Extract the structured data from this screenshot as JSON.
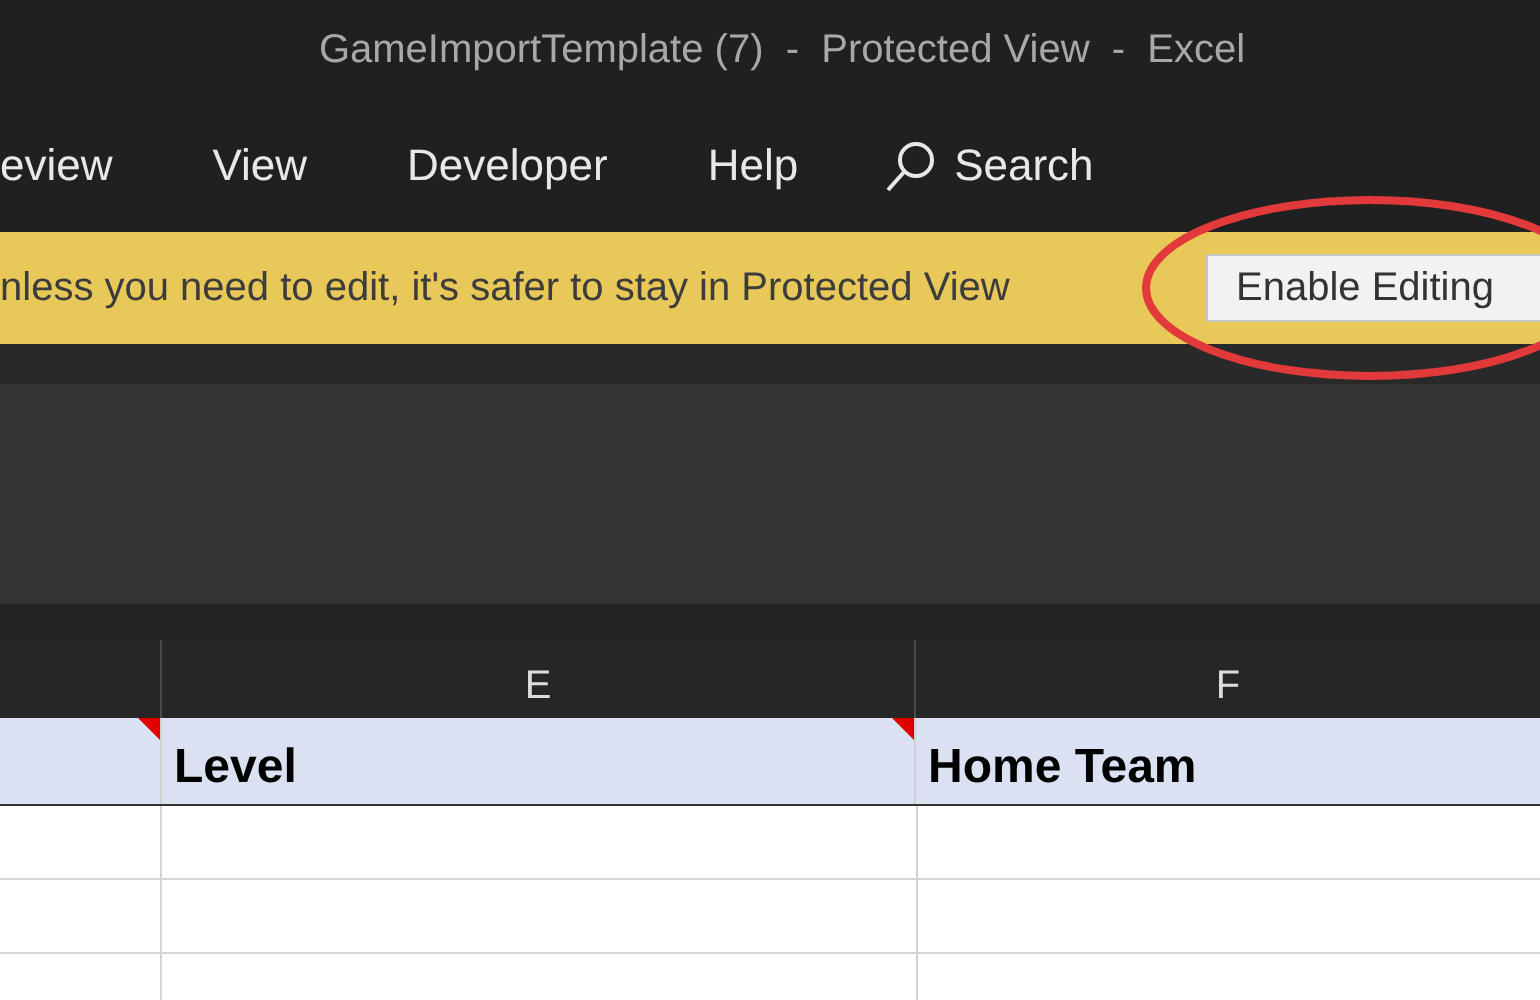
{
  "window": {
    "title": "GameImportTemplate (7)  -  Protected View  -  Excel"
  },
  "ribbon_tabs": [
    {
      "label": "eview"
    },
    {
      "label": "View"
    },
    {
      "label": "Developer"
    },
    {
      "label": "Help"
    }
  ],
  "search": {
    "label": "Search"
  },
  "message_bar": {
    "text": "nless you need to edit, it's safer to stay in Protected View",
    "button": "Enable Editing"
  },
  "sheet": {
    "columns": [
      "E",
      "F"
    ],
    "header_cells": [
      {
        "comment": true
      },
      {
        "text": "Level",
        "comment": true
      },
      {
        "text": "Home Team",
        "comment": false
      }
    ]
  }
}
